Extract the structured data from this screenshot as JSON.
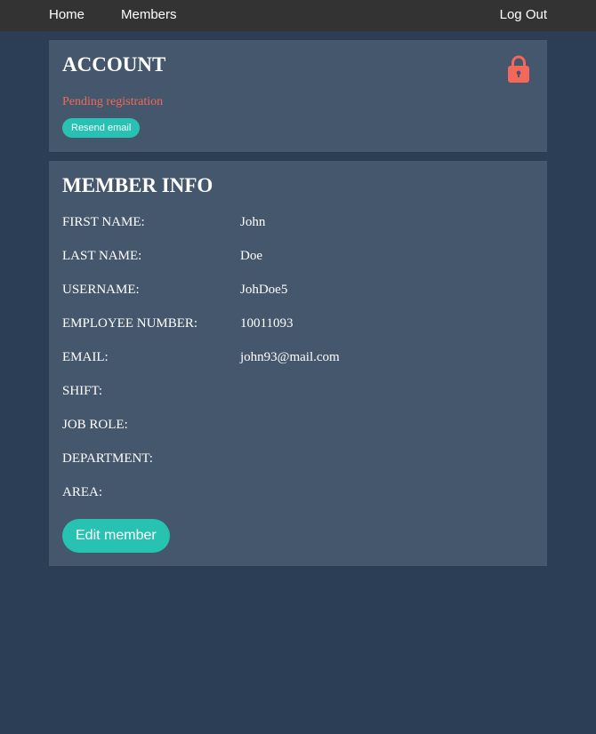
{
  "nav": {
    "home": "Home",
    "members": "Members",
    "logout": "Log Out"
  },
  "account": {
    "title": "ACCOUNT",
    "status": "Pending registration",
    "resend_label": "Resend email",
    "icon": "lock-icon",
    "status_color": "#f2685a"
  },
  "member": {
    "title": "MEMBER INFO",
    "fields": [
      {
        "label": "FIRST NAME:",
        "value": "John"
      },
      {
        "label": "LAST NAME:",
        "value": "Doe"
      },
      {
        "label": "USERNAME:",
        "value": "JohDoe5"
      },
      {
        "label": "EMPLOYEE NUMBER:",
        "value": "10011093"
      },
      {
        "label": "EMAIL:",
        "value": "john93@mail.com"
      },
      {
        "label": "SHIFT:",
        "value": ""
      },
      {
        "label": "JOB ROLE:",
        "value": ""
      },
      {
        "label": "DEPARTMENT:",
        "value": ""
      },
      {
        "label": "AREA:",
        "value": ""
      }
    ],
    "edit_label": "Edit member"
  },
  "colors": {
    "background": "#2c3e55",
    "navbar": "#333333",
    "card": "#44576c",
    "accent": "#27c2b2",
    "warning": "#f2685a"
  }
}
